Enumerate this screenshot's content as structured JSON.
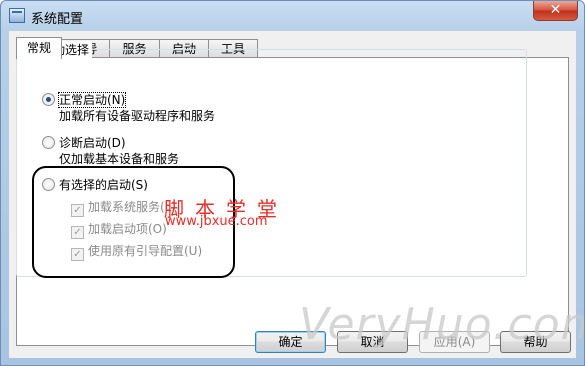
{
  "window": {
    "title": "系统配置",
    "close_glyph": "✕"
  },
  "tabs": [
    {
      "label": "常规",
      "active": true
    },
    {
      "label": "引导",
      "active": false
    },
    {
      "label": "服务",
      "active": false
    },
    {
      "label": "启动",
      "active": false
    },
    {
      "label": "工具",
      "active": false
    }
  ],
  "startup": {
    "group_label": "启动选择",
    "normal": {
      "label": "正常启动(N)",
      "desc": "加载所有设备驱动程序和服务",
      "selected": true
    },
    "diagnostic": {
      "label": "诊断启动(D)",
      "desc": "仅加载基本设备和服务",
      "selected": false
    },
    "selective": {
      "label": "有选择的启动(S)",
      "selected": false,
      "items": [
        {
          "label": "加载系统服务(L)",
          "checked": true,
          "enabled": false
        },
        {
          "label": "加载启动项(O)",
          "checked": true,
          "enabled": false
        },
        {
          "label": "使用原有引导配置(U)",
          "checked": true,
          "enabled": false
        }
      ]
    }
  },
  "buttons": {
    "ok": "确定",
    "cancel": "取消",
    "apply": "应用(A)",
    "help": "帮助"
  },
  "watermarks": {
    "site_cn": "脚本学堂",
    "site_url": "www.jbxue.com",
    "brand": "VeryHuo.com"
  },
  "colors": {
    "title_bar": "#b7cfe8",
    "close_button": "#c0301d",
    "highlight_border": "#000000",
    "watermark_red": "#e3302a"
  }
}
